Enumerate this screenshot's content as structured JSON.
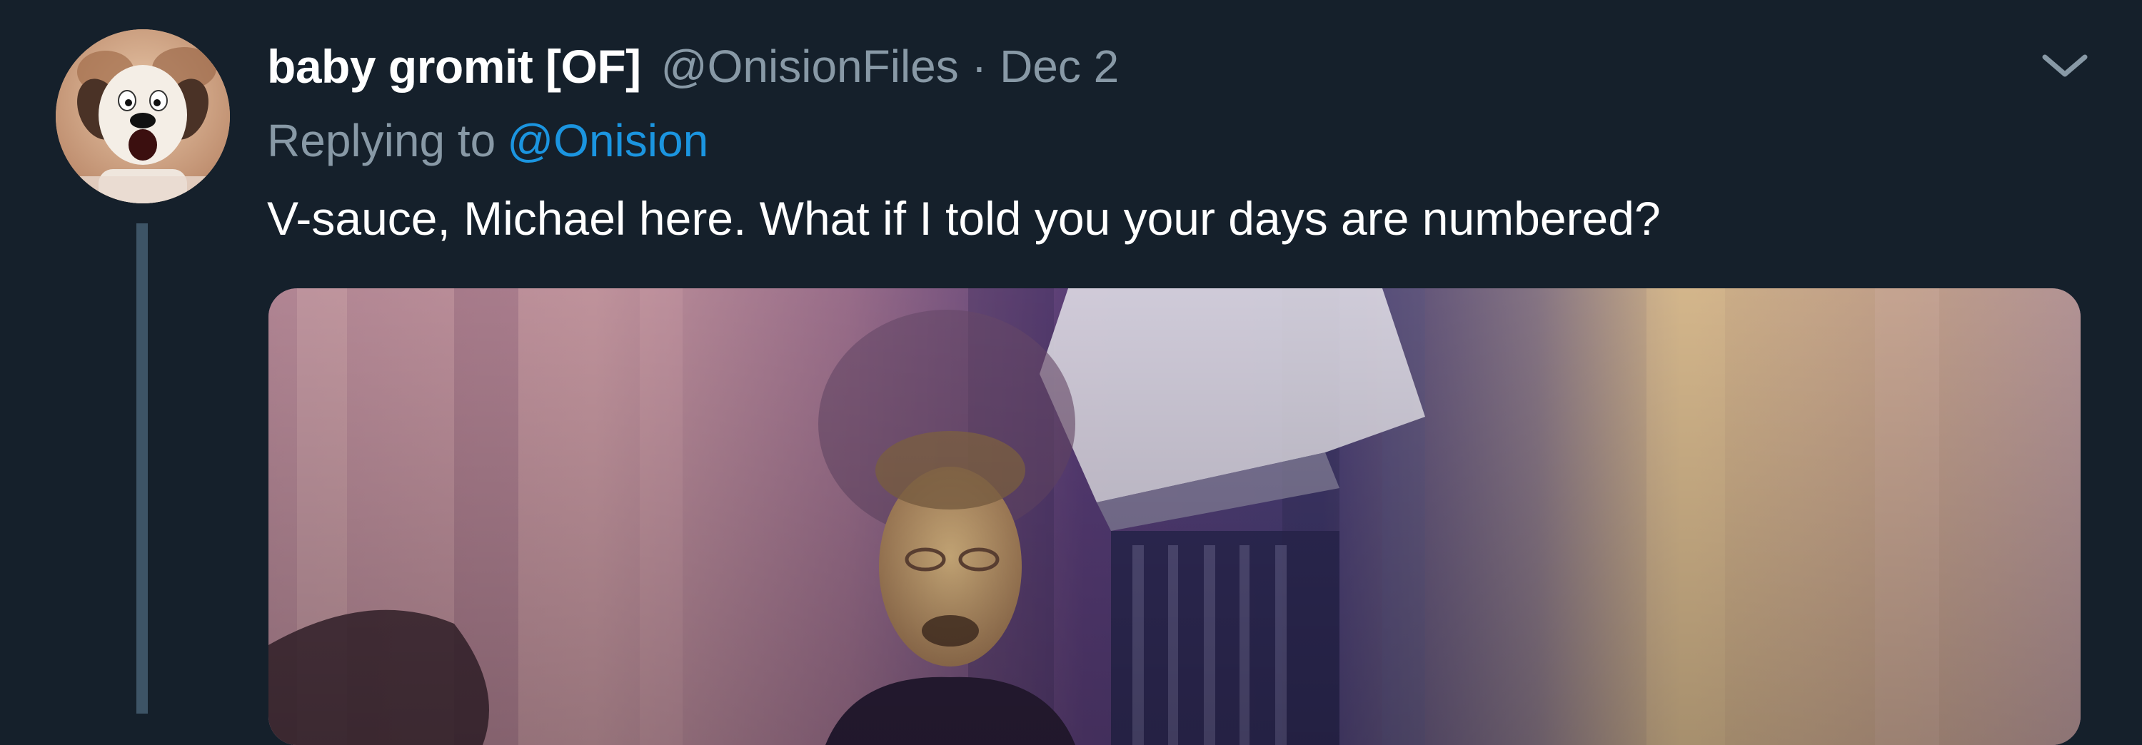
{
  "tweet": {
    "display_name": "baby gromit [OF]",
    "handle": "@OnisionFiles",
    "separator": "·",
    "date": "Dec 2",
    "replying_prefix": "Replying to",
    "replying_to": "@Onision",
    "text": "V-sauce, Michael here. What if I told you your days are numbered?"
  },
  "icons": {
    "menu": "chevron-down-icon",
    "avatar": "avatar-image",
    "media": "video-frame"
  },
  "colors": {
    "background": "#15202b",
    "link": "#1b95e0",
    "secondary_text": "#8899a6",
    "thread_line": "#3d5466"
  }
}
